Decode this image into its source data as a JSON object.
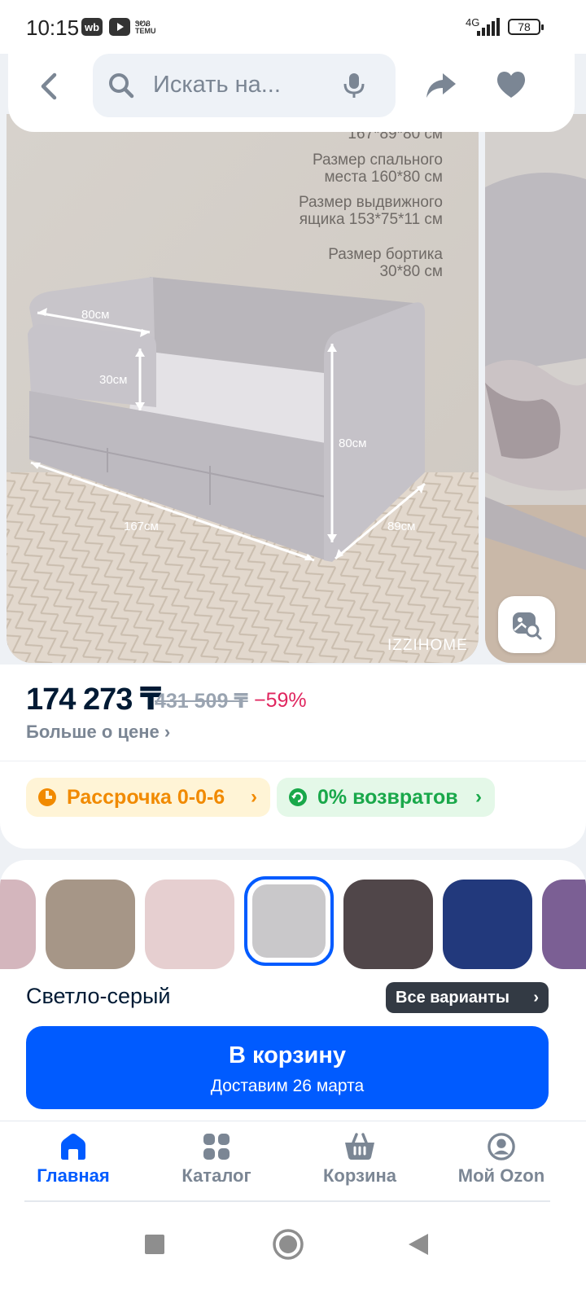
{
  "status_bar": {
    "time": "10:15",
    "apps": [
      "wb",
      "temu"
    ],
    "temu_top": "ᏕᏬᏰ",
    "network": "4G",
    "battery": "78"
  },
  "header": {
    "search_placeholder": "Искать на..."
  },
  "gallery": {
    "dims_cut": "167*89*80 см",
    "spec_1": [
      "Размер спального",
      "места 160*80 см"
    ],
    "spec_2": [
      "Размер выдвижного",
      "ящика 153*75*11 см"
    ],
    "spec_3": [
      "Размер бортика",
      "30*80 см"
    ],
    "labels": {
      "width_top": "80см",
      "side_height": "30см",
      "height": "80см",
      "length": "167см",
      "depth": "89см"
    },
    "brand": "IZZIHOME"
  },
  "price": {
    "current": "174 273 ₸",
    "old": "431 509 ₸",
    "discount": "−59%",
    "more_link": "Больше о цене"
  },
  "promos": {
    "installment": "Рассрочка 0-0-6",
    "returns": "0% возвратов"
  },
  "variants": {
    "selected_name": "Светло-серый",
    "all_label": "Все варианты",
    "swatch_colors": [
      "#d4b6bd",
      "#a69687",
      "#e6cfd0",
      "#c9c8ca",
      "#504649",
      "#22397c",
      "#7b5f94"
    ]
  },
  "cart": {
    "title": "В корзину",
    "subtitle": "Доставим 26 марта"
  },
  "nav": {
    "items": [
      {
        "label": "Главная",
        "active": true
      },
      {
        "label": "Каталог",
        "active": false
      },
      {
        "label": "Корзина",
        "active": false
      },
      {
        "label": "Мой Ozon",
        "active": false
      }
    ]
  },
  "colors": {
    "accent": "#005bff",
    "discount": "#e0265f",
    "installment": "#f18a00",
    "returns": "#19a84a"
  }
}
